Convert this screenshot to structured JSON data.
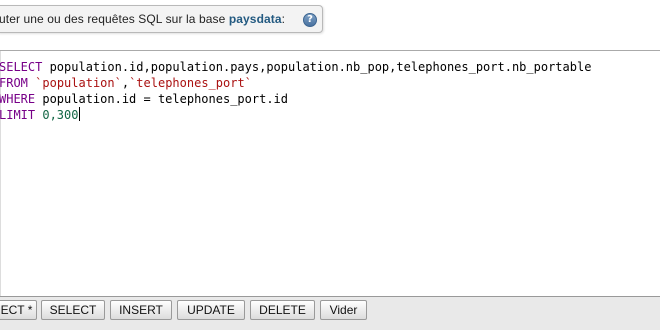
{
  "header": {
    "prefix": "uter une ou des requêtes SQL sur la base ",
    "database": "paysdata",
    "suffix": ":",
    "help_icon": "?"
  },
  "editor": {
    "lines": [
      [
        {
          "cls": "kw",
          "text": "SELECT"
        },
        {
          "cls": "id",
          "text": " population.id,population.pays,population.nb_pop,telephones_port.nb_portable"
        }
      ],
      [
        {
          "cls": "kw",
          "text": "FROM"
        },
        {
          "cls": "id",
          "text": " "
        },
        {
          "cls": "str",
          "text": "`population`"
        },
        {
          "cls": "id",
          "text": ","
        },
        {
          "cls": "str",
          "text": "`telephones_port`"
        }
      ],
      [
        {
          "cls": "kw",
          "text": "WHERE"
        },
        {
          "cls": "id",
          "text": " population.id "
        },
        {
          "cls": "op",
          "text": "="
        },
        {
          "cls": "id",
          "text": " telephones_port.id"
        }
      ],
      [
        {
          "cls": "kw",
          "text": "LIMIT"
        },
        {
          "cls": "id",
          "text": " "
        },
        {
          "cls": "num",
          "text": "0,300"
        }
      ]
    ]
  },
  "toolbar": {
    "buttons": [
      {
        "name": "select-star-button",
        "label": "ECT *"
      },
      {
        "name": "select-button",
        "label": "SELECT"
      },
      {
        "name": "insert-button",
        "label": "INSERT"
      },
      {
        "name": "update-button",
        "label": "UPDATE"
      },
      {
        "name": "delete-button",
        "label": "DELETE"
      },
      {
        "name": "clear-button",
        "label": "Vider"
      }
    ]
  },
  "colors": {
    "keyword": "#770088",
    "string": "#aa1111",
    "number": "#116644",
    "database": "#235a81"
  }
}
